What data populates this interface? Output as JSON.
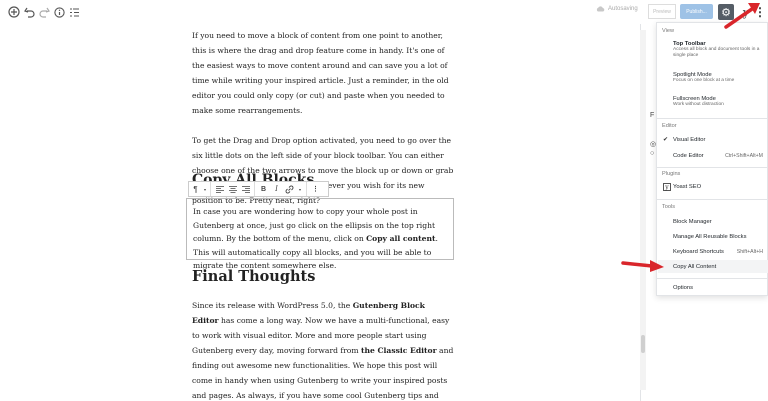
{
  "toolbar": {
    "autosave_label": "Autosaving",
    "preview_label": "Preview",
    "publish_label": "Publish...",
    "yoast_glyph": "y",
    "more_glyph": "⋮",
    "gear_glyph": "⚙"
  },
  "content": {
    "paragraphs": [
      "If you need to move a block of content from one point to another, this is where the drag and drop feature come in handy. It's one of the easiest ways to move content around and can save you a lot of time while writing your inspired article. Just a reminder, in the old editor you could only copy (or cut) and paste when you needed to make some rearrangements.",
      "To get the Drag and Drop option activated, you need to go over the six little dots on the left side of your block toolbar. You can either choose one of the two arrows to move the block up or down or grab the dots and move your block wherever you wish for its new position to be. Pretty neat, right?"
    ],
    "copy_heading": "Copy All Blocks",
    "selected_block": {
      "before": "In case you are wondering how to copy your whole post in Gutenberg at once, just go click on the ellipsis on the top right column. By the bottom of the menu, click on ",
      "bold": "Copy all content",
      "after": ". This will automatically copy all blocks, and you will be able to migrate the content somewhere else."
    },
    "final_heading": "Final Thoughts",
    "final_para": {
      "p1": "Since its release with WordPress 5.0, the ",
      "b1": "Gutenberg Block Editor",
      "p2": " has come a long way. Now we have a multi-functional, easy to work with visual editor. More and more people start using Gutenberg every day, moving forward from ",
      "b2": "the Classic Editor",
      "p3": " and finding out awesome new functionalities. We hope this post will come in handy when using Gutenberg to write your inspired posts and pages. As always, if you have some cool Gutenberg tips and tricks, feel free to share them in the comment section."
    }
  },
  "menu": {
    "view_label": "View",
    "top_toolbar": {
      "title": "Top Toolbar",
      "desc": "Access all block and document tools in a single place"
    },
    "spotlight": {
      "title": "Spotlight Mode",
      "desc": "Focus on one block at a time"
    },
    "fullscreen": {
      "title": "Fullscreen Mode",
      "desc": "Work without distraction"
    },
    "editor_label": "Editor",
    "visual_editor": "Visual Editor",
    "code_editor": "Code Editor",
    "code_editor_shortcut": "Ctrl+Shift+Alt+M",
    "plugins_label": "Plugins",
    "yoast_seo": "Yoast SEO",
    "tools_label": "Tools",
    "block_manager": "Block Manager",
    "manage_reusable": "Manage All Reusable Blocks",
    "keyboard_shortcuts": "Keyboard Shortcuts",
    "keyboard_shortcuts_key": "Shift+Alt+H",
    "copy_all": "Copy All Content",
    "options": "Options"
  },
  "colors": {
    "arrow_red": "#d9262b",
    "publish_blue": "#9ec2e6",
    "gear_dark": "#555d66"
  }
}
